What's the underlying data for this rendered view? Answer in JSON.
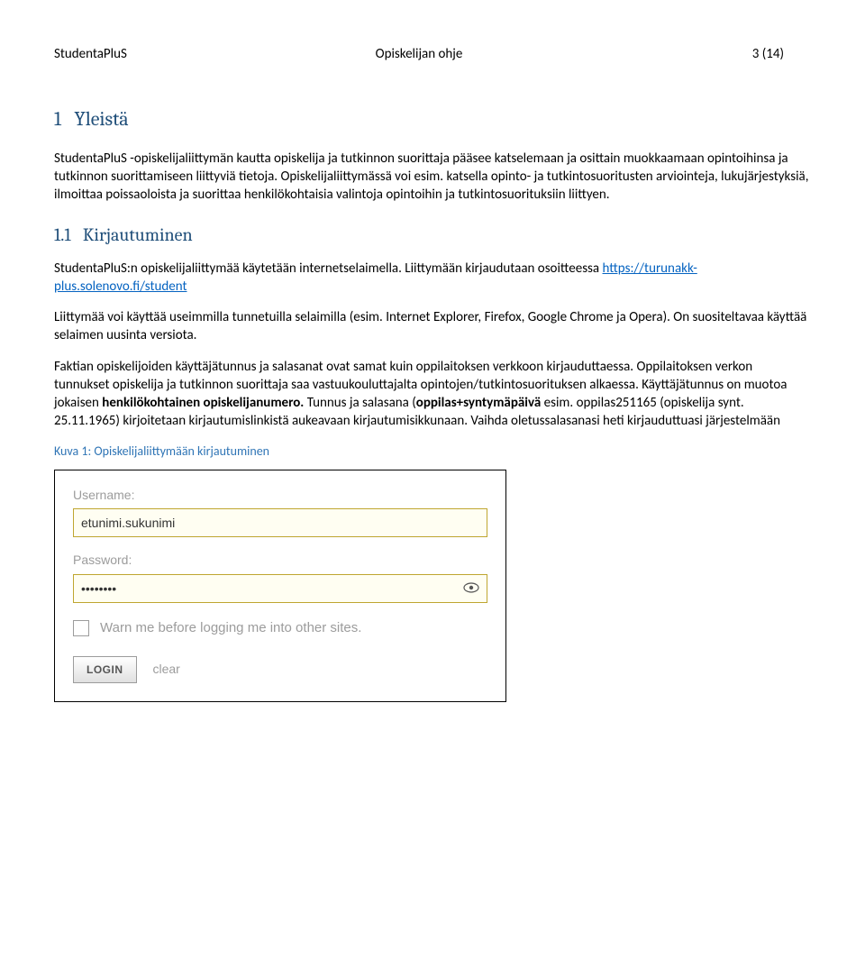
{
  "header": {
    "left": "StudentaPluS",
    "center": "Opiskelijan ohje",
    "right": "3 (14)"
  },
  "section1": {
    "number": "1",
    "title": "Yleistä",
    "para1": "StudentaPluS -opiskelijaliittymän kautta opiskelija ja tutkinnon suorittaja pääsee katselemaan ja osittain muokkaamaan opintoihinsa ja tutkinnon suorittamiseen liittyviä tietoja. Opiskelijaliittymässä voi esim. katsella opinto- ja tutkintosuoritusten arviointeja, lukujärjestyksiä, ilmoittaa poissaoloista ja suorittaa henkilökohtaisia valintoja opintoihin ja tutkintosuorituksiin liittyen."
  },
  "section11": {
    "number": "1.1",
    "title": "Kirjautuminen",
    "para1_a": "StudentaPluS:n opiskelijaliittymää käytetään internetselaimella. Liittymään kirjaudutaan osoitteessa ",
    "link": "https://turunakk-plus.solenovo.fi/student",
    "para2": "Liittymää voi käyttää useimmilla tunnetuilla selaimilla (esim. Internet Explorer, Firefox, Google Chrome ja Opera). On suositeltavaa käyttää selaimen uusinta versiota.",
    "para3_a": "Faktian opiskelijoiden käyttäjätunnus ja salasanat ovat samat kuin oppilaitoksen verkkoon kirjauduttaessa. Oppilaitoksen verkon tunnukset opiskelija ja tutkinnon suorittaja saa vastuukouluttajalta opintojen/tutkintosuorituksen alkaessa. Käyttäjätunnus on muotoa jokaisen ",
    "para3_bold1": "henkilökohtainen opiskelijanumero.",
    "para3_b": " Tunnus ja salasana (",
    "para3_bold2": "oppilas+syntymäpäivä",
    "para3_c": " esim. oppilas251165 (opiskelija synt. 25.11.1965) kirjoitetaan kirjautumislinkistä aukeavaan kirjautumisikkunaan. Vaihda oletussalasanasi heti kirjauduttuasi järjestelmään"
  },
  "figure": {
    "caption": "Kuva 1: Opiskelijaliittymään kirjautuminen"
  },
  "login": {
    "username_label": "Username:",
    "username_value": "etunimi.sukunimi",
    "password_label": "Password:",
    "password_value": "••••••••",
    "remember": "Warn me before logging me into other sites.",
    "login_btn": "LOGIN",
    "clear_btn": "clear"
  }
}
